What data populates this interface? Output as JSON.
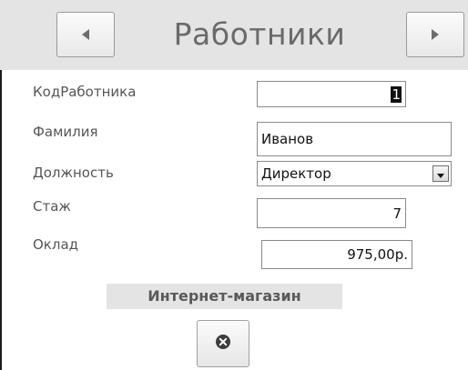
{
  "header": {
    "title": "Работники",
    "prev_icon": "triangle-left-icon",
    "next_icon": "triangle-right-icon"
  },
  "form": {
    "fields": [
      {
        "label": "КодРаботника",
        "value": "1"
      },
      {
        "label": "Фамилия",
        "value": "Иванов"
      },
      {
        "label": "Должность",
        "value": "Директор"
      },
      {
        "label": "Стаж",
        "value": "7"
      },
      {
        "label": "Оклад",
        "value": "975,00р."
      }
    ]
  },
  "footer": {
    "caption": "Интернет-магазин",
    "close_icon": "close-circle-icon"
  },
  "colors": {
    "header_bg": "#e4e4e4",
    "title_text": "#6a6a6a",
    "label_text": "#555555"
  }
}
